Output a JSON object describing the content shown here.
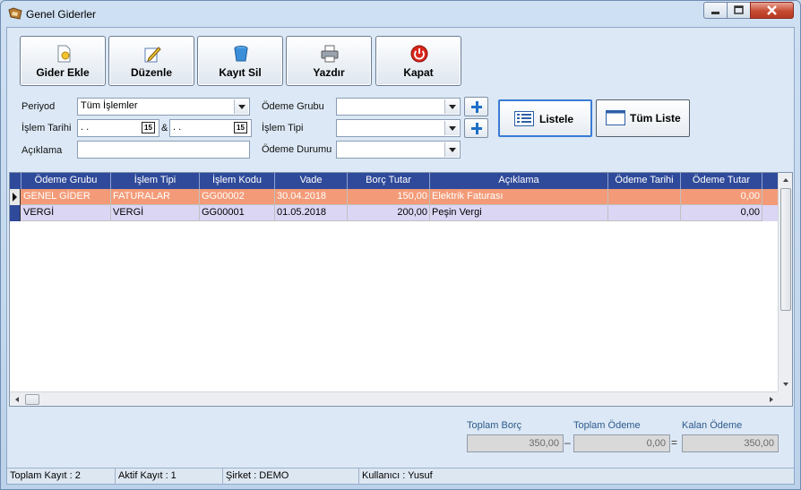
{
  "window": {
    "title": "Genel Giderler"
  },
  "toolbar": {
    "add_label": "Gider Ekle",
    "edit_label": "Düzenle",
    "delete_label": "Kayıt Sil",
    "print_label": "Yazdır",
    "close_label": "Kapat"
  },
  "filters": {
    "period_label": "Periyod",
    "period_value": "Tüm İşlemler",
    "date_label": "İşlem Tarihi",
    "date_from": " .  .",
    "date_sep": "&",
    "date_to": " .  .",
    "desc_label": "Açıklama",
    "desc_value": "",
    "pay_group_label": "Ödeme Grubu",
    "pay_group_value": "",
    "txn_type_label": "İşlem Tipi",
    "txn_type_value": "",
    "pay_status_label": "Ödeme Durumu",
    "pay_status_value": "",
    "calendar_glyph": "15"
  },
  "actions": {
    "list_label": "Listele",
    "list_all_label": "Tüm Liste"
  },
  "grid": {
    "columns": [
      "Ödeme Grubu",
      "İşlem Tipi",
      "İşlem Kodu",
      "Vade",
      "Borç Tutar",
      "Açıklama",
      "Ödeme Tarihi",
      "Ödeme Tutar"
    ],
    "rows": [
      [
        "GENEL GİDER",
        "FATURALAR",
        "GG00002",
        "30.04.2018",
        "150,00",
        "Elektrik Faturası",
        "",
        "0,00"
      ],
      [
        "VERGİ",
        "VERGİ",
        "GG00001",
        "01.05.2018",
        "200,00",
        "Peşin Vergi",
        "",
        "0,00"
      ]
    ]
  },
  "totals": {
    "total_debt_label": "Toplam Borç",
    "total_debt_value": "350,00",
    "minus": "–",
    "total_paid_label": "Toplam Ödeme",
    "total_paid_value": "0,00",
    "equals": "=",
    "remaining_label": "Kalan Ödeme",
    "remaining_value": "350,00"
  },
  "status": {
    "total_records": "Toplam Kayıt : 2",
    "active_record": "Aktif Kayıt : 1",
    "company": "Şirket : DEMO",
    "user": "Kullanıcı : Yusuf"
  },
  "colors": {
    "header_bg": "#2f4a9a",
    "row_selected_bg": "#f39b78",
    "row_alt_bg": "#dcd6f5",
    "accent": "#3a7bd5"
  },
  "icons": {
    "add": "new-document-icon",
    "edit": "pencil-edit-icon",
    "delete": "trash-bin-icon",
    "print": "printer-icon",
    "close": "power-icon",
    "list": "list-icon",
    "list_all": "window-icon"
  }
}
